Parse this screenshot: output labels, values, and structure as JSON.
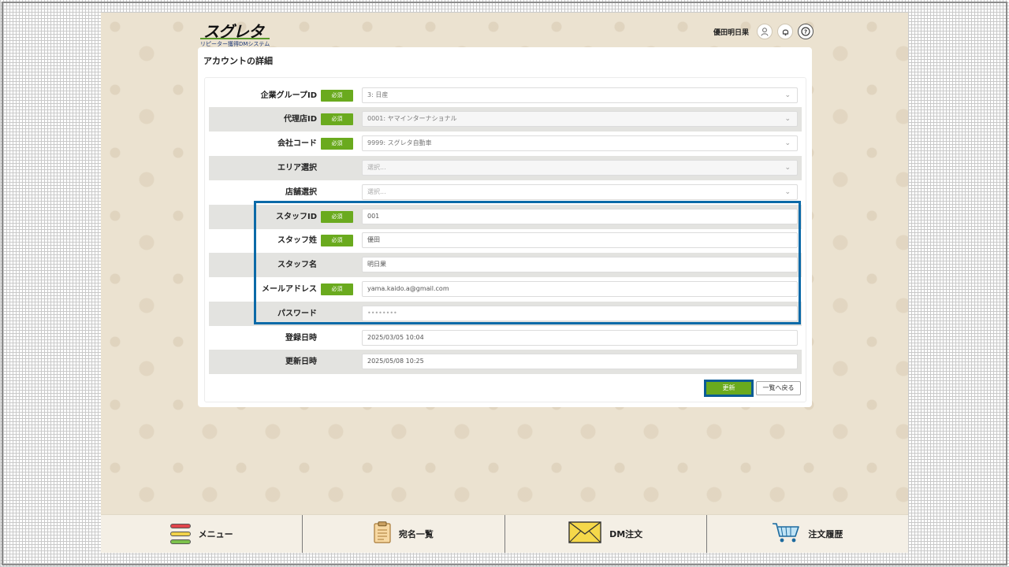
{
  "header": {
    "logo_main": "スグレタ",
    "logo_sub": "リピーター獲得DMシステム",
    "user_name": "優田明日果"
  },
  "panel": {
    "title": "アカウントの詳細",
    "required_badge": "必須"
  },
  "form": {
    "company_group": {
      "label": "企業グループID",
      "value": "3: 日産",
      "required": true
    },
    "agency": {
      "label": "代理店ID",
      "value": "0001: ヤマインターナショナル",
      "required": true
    },
    "company_code": {
      "label": "会社コード",
      "value": "9999: スグレタ自動車",
      "required": true
    },
    "area": {
      "label": "エリア選択",
      "placeholder": "選択..."
    },
    "store": {
      "label": "店舗選択",
      "placeholder": "選択..."
    },
    "staff_id": {
      "label": "スタッフID",
      "value": "001",
      "required": true
    },
    "staff_last": {
      "label": "スタッフ姓",
      "value": "優田",
      "required": true
    },
    "staff_first": {
      "label": "スタッフ名",
      "value": "明日果"
    },
    "email": {
      "label": "メールアドレス",
      "value": "yama.kaido.a@gmail.com",
      "required": true
    },
    "password": {
      "label": "パスワード",
      "placeholder": "••••••••"
    },
    "registered": {
      "label": "登録日時",
      "value": "2025/03/05 10:04"
    },
    "updated": {
      "label": "更新日時",
      "value": "2025/05/08 10:25"
    }
  },
  "actions": {
    "update_label": "更新",
    "back_label": "一覧へ戻る"
  },
  "bottom_nav": {
    "menu": "メニュー",
    "addresses": "宛名一覧",
    "dm_order": "DM注文",
    "order_history": "注文履歴"
  },
  "colors": {
    "accent_green": "#6aaa1e",
    "highlight_blue": "#0b6aa8",
    "background_beige": "#ebe2d0"
  },
  "icons": [
    "user-icon",
    "bell-icon",
    "help-icon",
    "menu-icon",
    "clipboard-icon",
    "envelope-icon",
    "cart-icon",
    "chevron-down-icon"
  ]
}
